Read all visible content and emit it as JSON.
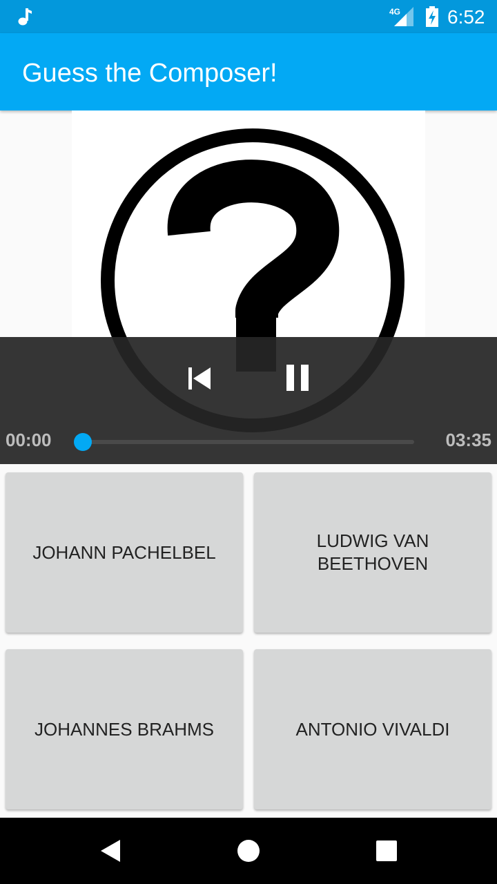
{
  "status_bar": {
    "time": "6:52",
    "network": "4G",
    "icons": [
      "music-note-icon",
      "signal-4g-icon",
      "battery-charging-icon"
    ]
  },
  "app_bar": {
    "title": "Guess the Composer!",
    "color": "#03a9f4"
  },
  "artwork": {
    "icon": "question-mark-circle-icon"
  },
  "player": {
    "position": "00:00",
    "duration": "03:35",
    "progress": 0,
    "controls": [
      "skip-previous-icon",
      "pause-icon"
    ],
    "accent": "#03a9f4"
  },
  "answers": [
    {
      "label": "JOHANN PACHELBEL"
    },
    {
      "label": "LUDWIG VAN BEETHOVEN"
    },
    {
      "label": "JOHANNES BRAHMS"
    },
    {
      "label": "ANTONIO VIVALDI"
    }
  ],
  "nav_bar": {
    "icons": [
      "back-icon",
      "home-icon",
      "recents-icon"
    ]
  }
}
